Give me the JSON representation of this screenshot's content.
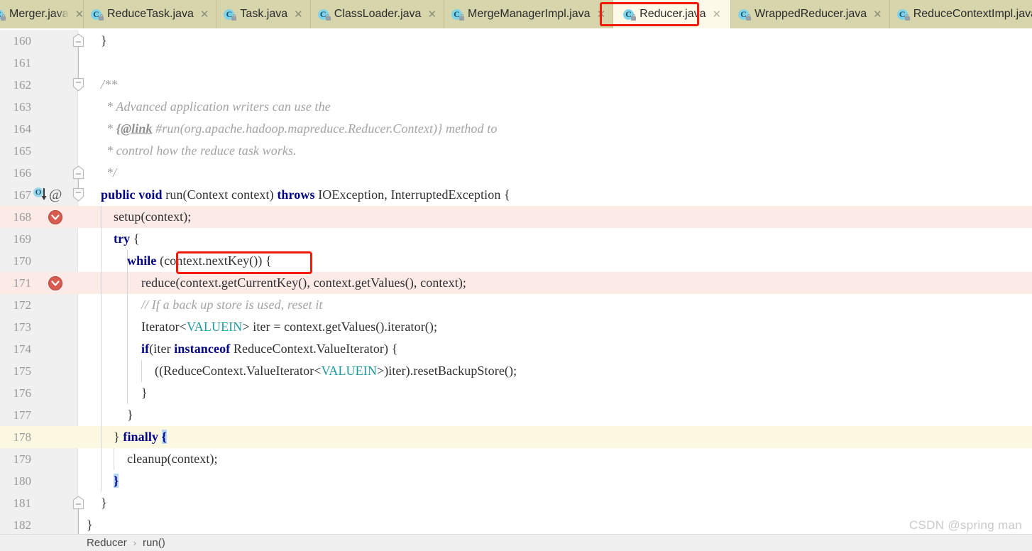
{
  "window": {
    "watermark": "CSDN @spring man"
  },
  "tabs": {
    "items": [
      {
        "label": "Merger.java",
        "icon": "java-class-icon",
        "active": false,
        "truncated": true
      },
      {
        "label": "ReduceTask.java",
        "icon": "java-class-icon",
        "active": false,
        "truncated": false
      },
      {
        "label": "Task.java",
        "icon": "java-class-icon",
        "active": false,
        "truncated": false
      },
      {
        "label": "ClassLoader.java",
        "icon": "java-class-icon",
        "active": false,
        "truncated": false
      },
      {
        "label": "MergeManagerImpl.java",
        "icon": "java-class-icon",
        "active": false,
        "truncated": false
      },
      {
        "label": "Reducer.java",
        "icon": "java-class-icon",
        "active": true,
        "truncated": false
      },
      {
        "label": "WrappedReducer.java",
        "icon": "java-class-icon",
        "active": false,
        "truncated": false
      },
      {
        "label": "ReduceContextImpl.java",
        "icon": "java-class-icon",
        "active": false,
        "truncated": false
      }
    ],
    "close_glyph": "✕",
    "class_letter": "C"
  },
  "breadcrumb": {
    "class": "Reducer",
    "separator": "›",
    "member": "run()"
  },
  "annotations": {
    "tab_highlight_color": "#f21b0c",
    "code_highlight_color": "#f21b0c"
  },
  "editor": {
    "colors": {
      "gutter_bg": "#f0f0f0",
      "error_line_bg": "#fceae7",
      "caret_line_bg": "#fdf8e2",
      "keyword": "#000086",
      "comment": "#a3a3a3",
      "type_param": "#20999d",
      "selection": "#b6d6fb"
    },
    "lines": [
      {
        "num": "160",
        "text": "}"
      },
      {
        "num": "161",
        "text": ""
      },
      {
        "num": "162",
        "text": "/**"
      },
      {
        "num": "163",
        "text": "* Advanced application writers can use the"
      },
      {
        "num": "164",
        "text": "* {@link #run(org.apache.hadoop.mapreduce.Reducer.Context)} method to"
      },
      {
        "num": "165",
        "text": "* control how the reduce task works."
      },
      {
        "num": "166",
        "text": "*/"
      },
      {
        "num": "167",
        "text": "public void run(Context context) throws IOException, InterruptedException {"
      },
      {
        "num": "168",
        "text": "setup(context);"
      },
      {
        "num": "169",
        "text": "try {"
      },
      {
        "num": "170",
        "text": "while (context.nextKey()) {"
      },
      {
        "num": "171",
        "text": "reduce(context.getCurrentKey(), context.getValues(), context);"
      },
      {
        "num": "172",
        "text": "// If a back up store is used, reset it"
      },
      {
        "num": "173",
        "text": "Iterator<VALUEIN> iter = context.getValues().iterator();"
      },
      {
        "num": "174",
        "text": "if(iter instanceof ReduceContext.ValueIterator) {"
      },
      {
        "num": "175",
        "text": "((ReduceContext.ValueIterator<VALUEIN>)iter).resetBackupStore();"
      },
      {
        "num": "176",
        "text": "}"
      },
      {
        "num": "177",
        "text": "}"
      },
      {
        "num": "178",
        "text": "} finally {"
      },
      {
        "num": "179",
        "text": "cleanup(context);"
      },
      {
        "num": "180",
        "text": "}"
      },
      {
        "num": "181",
        "text": "}"
      },
      {
        "num": "182",
        "text": "}"
      }
    ],
    "gutter_icons": {
      "line_167": [
        "overriding-method-icon",
        "annotation-icon"
      ],
      "line_168": [
        "breakpoint-icon"
      ],
      "line_171": [
        "breakpoint-icon"
      ]
    },
    "annotation_glyph": "@",
    "override_glyph": "O"
  }
}
